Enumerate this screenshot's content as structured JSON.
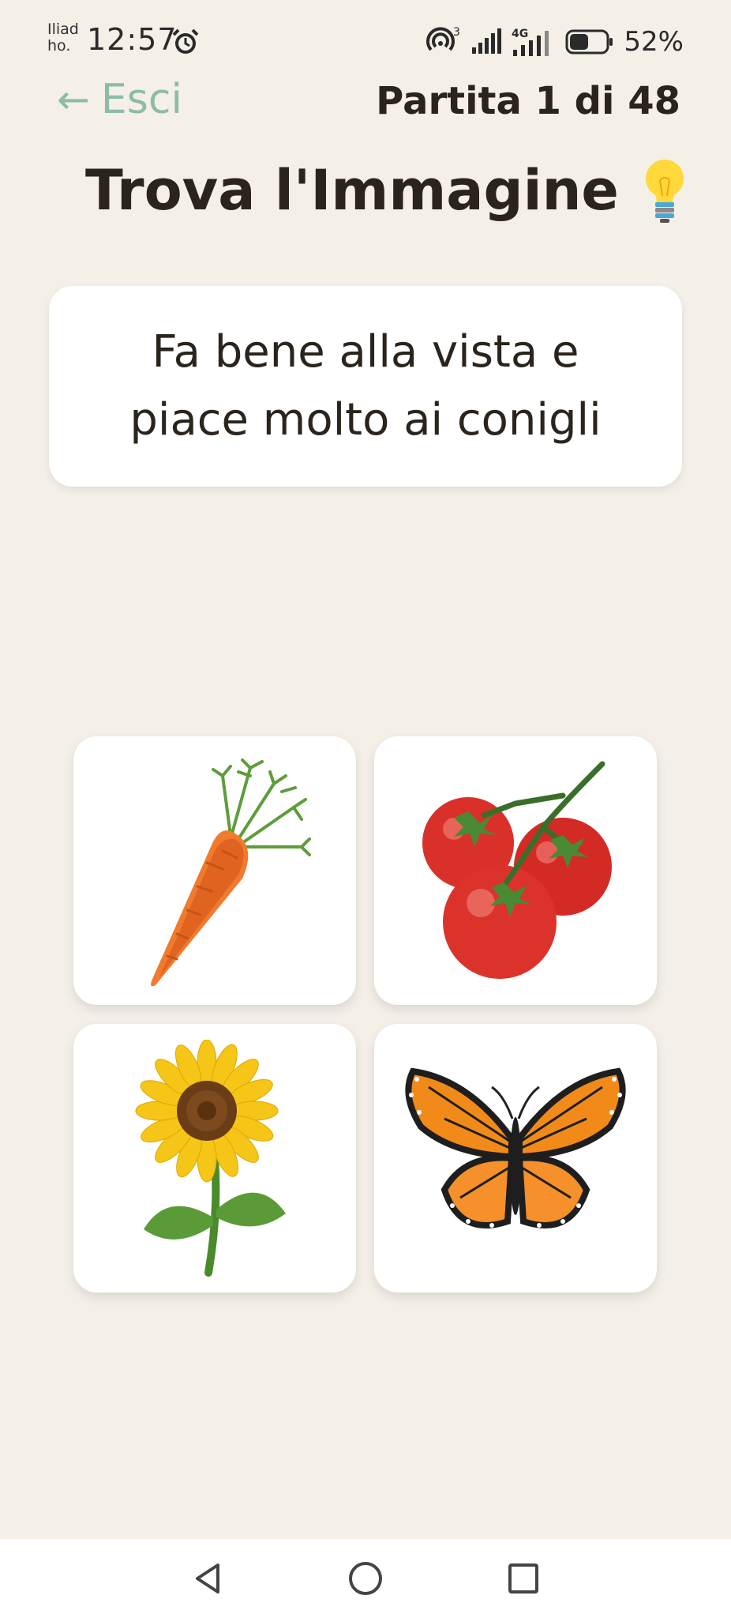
{
  "status_bar": {
    "carrier_line1": "Iliad",
    "carrier_line2": "ho.",
    "time": "12:57",
    "network_badge": "3",
    "network_type": "4G",
    "battery_percent": "52%",
    "battery_level": 0.52
  },
  "header": {
    "back_label": "Esci",
    "back_arrow": "←",
    "progress_label": "Partita 1 di 48"
  },
  "title": "Trova l'Immagine",
  "clue": "Fa bene alla vista e piace molto ai conigli",
  "cards": [
    {
      "icon": "carrot-icon"
    },
    {
      "icon": "tomatoes-icon"
    },
    {
      "icon": "sunflower-icon"
    },
    {
      "icon": "butterfly-icon"
    }
  ],
  "nav": {
    "back": "triangle-back-icon",
    "home": "circle-home-icon",
    "recents": "square-recents-icon"
  },
  "colors": {
    "background": "#f4efe7",
    "accent": "#8cbca8",
    "text": "#2a241c",
    "card": "#ffffff"
  }
}
